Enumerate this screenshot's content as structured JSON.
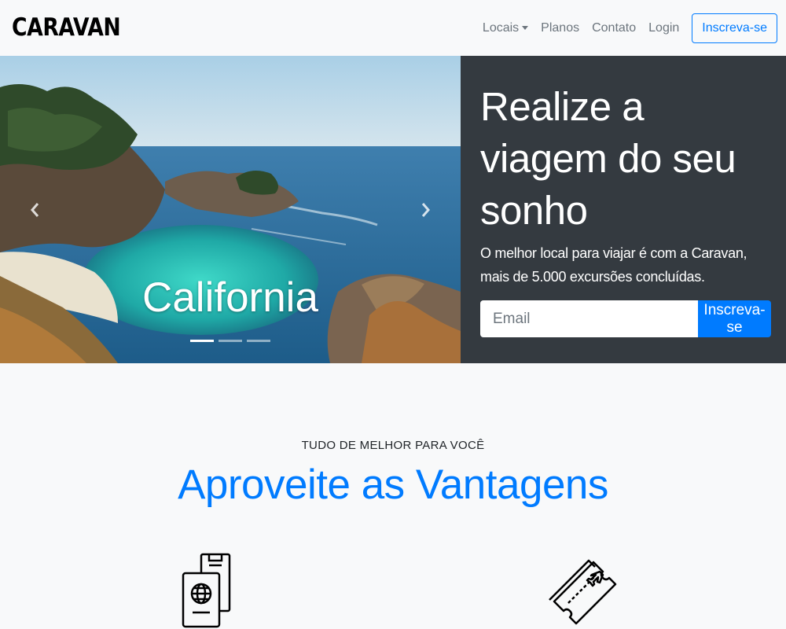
{
  "brand": "CARAVAN",
  "nav": {
    "items": [
      {
        "label": "Locais",
        "dropdown": true
      },
      {
        "label": "Planos"
      },
      {
        "label": "Contato"
      },
      {
        "label": "Login"
      }
    ],
    "cta": "Inscreva-se"
  },
  "carousel": {
    "caption": "California",
    "slides": 3,
    "active_slide": 1,
    "prev_icon": "chevron-left-icon",
    "next_icon": "chevron-right-icon"
  },
  "hero": {
    "title": "Realize a viagem do seu sonho",
    "subtitle": "O melhor local para viajar é com a Caravan, mais de 5.000 excursões concluídas.",
    "email_placeholder": "Email",
    "email_value": "",
    "submit_label": "Inscreva-se"
  },
  "benefits": {
    "eyebrow": "TUDO DE MELHOR PARA VOCÊ",
    "title": "Aproveite as Vantagens",
    "icons": [
      "passport-icon",
      "plane-ticket-icon"
    ]
  },
  "colors": {
    "primary": "#007bff",
    "dark_panel": "#343a40",
    "background": "#f8f9fa",
    "nav_text": "#6c757d"
  }
}
